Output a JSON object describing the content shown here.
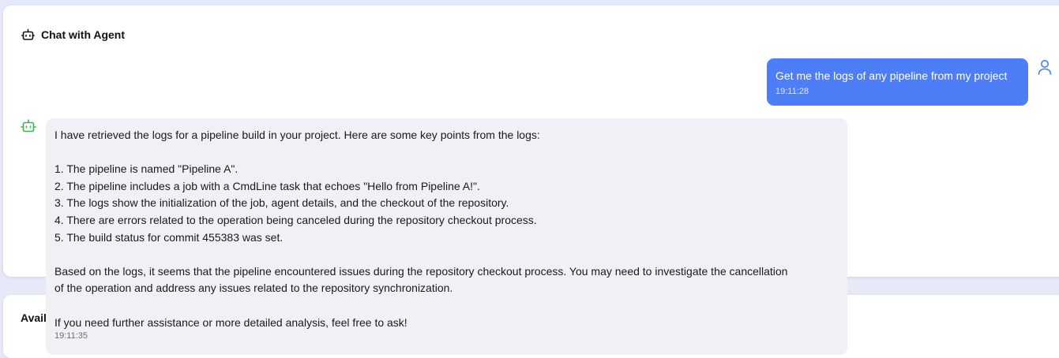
{
  "chat_panel": {
    "title": "Chat with Agent",
    "icon": "bot-icon"
  },
  "messages": {
    "user": {
      "text": "Get me the logs of any pipeline from my project",
      "time": "19:11:28",
      "avatar_icon": "user-icon",
      "bubble_color": "#4d7ef8"
    },
    "agent": {
      "lines": [
        "I have retrieved the logs for a pipeline build in your project. Here are some key points from the logs:",
        "",
        "1. The pipeline is named \"Pipeline A\".",
        "2. The pipeline includes a job with a CmdLine task that echoes \"Hello from Pipeline A!\".",
        "3. The logs show the initialization of the job, agent details, and the checkout of the repository.",
        "4. There are errors related to the operation being canceled during the repository checkout process.",
        "5. The build status for commit 455383 was set.",
        "",
        "Based on the logs, it seems that the pipeline encountered issues during the repository checkout process. You may need to investigate the cancellation",
        "of the operation and address any issues related to the repository synchronization.",
        "",
        "If you need further assistance or more detailed analysis, feel free to ask!"
      ],
      "time": "19:11:35",
      "avatar_icon": "bot-icon",
      "avatar_color": "#3cb54a",
      "bubble_color": "#f0f1f5"
    }
  },
  "available_panel": {
    "title_visible": "Avail"
  }
}
